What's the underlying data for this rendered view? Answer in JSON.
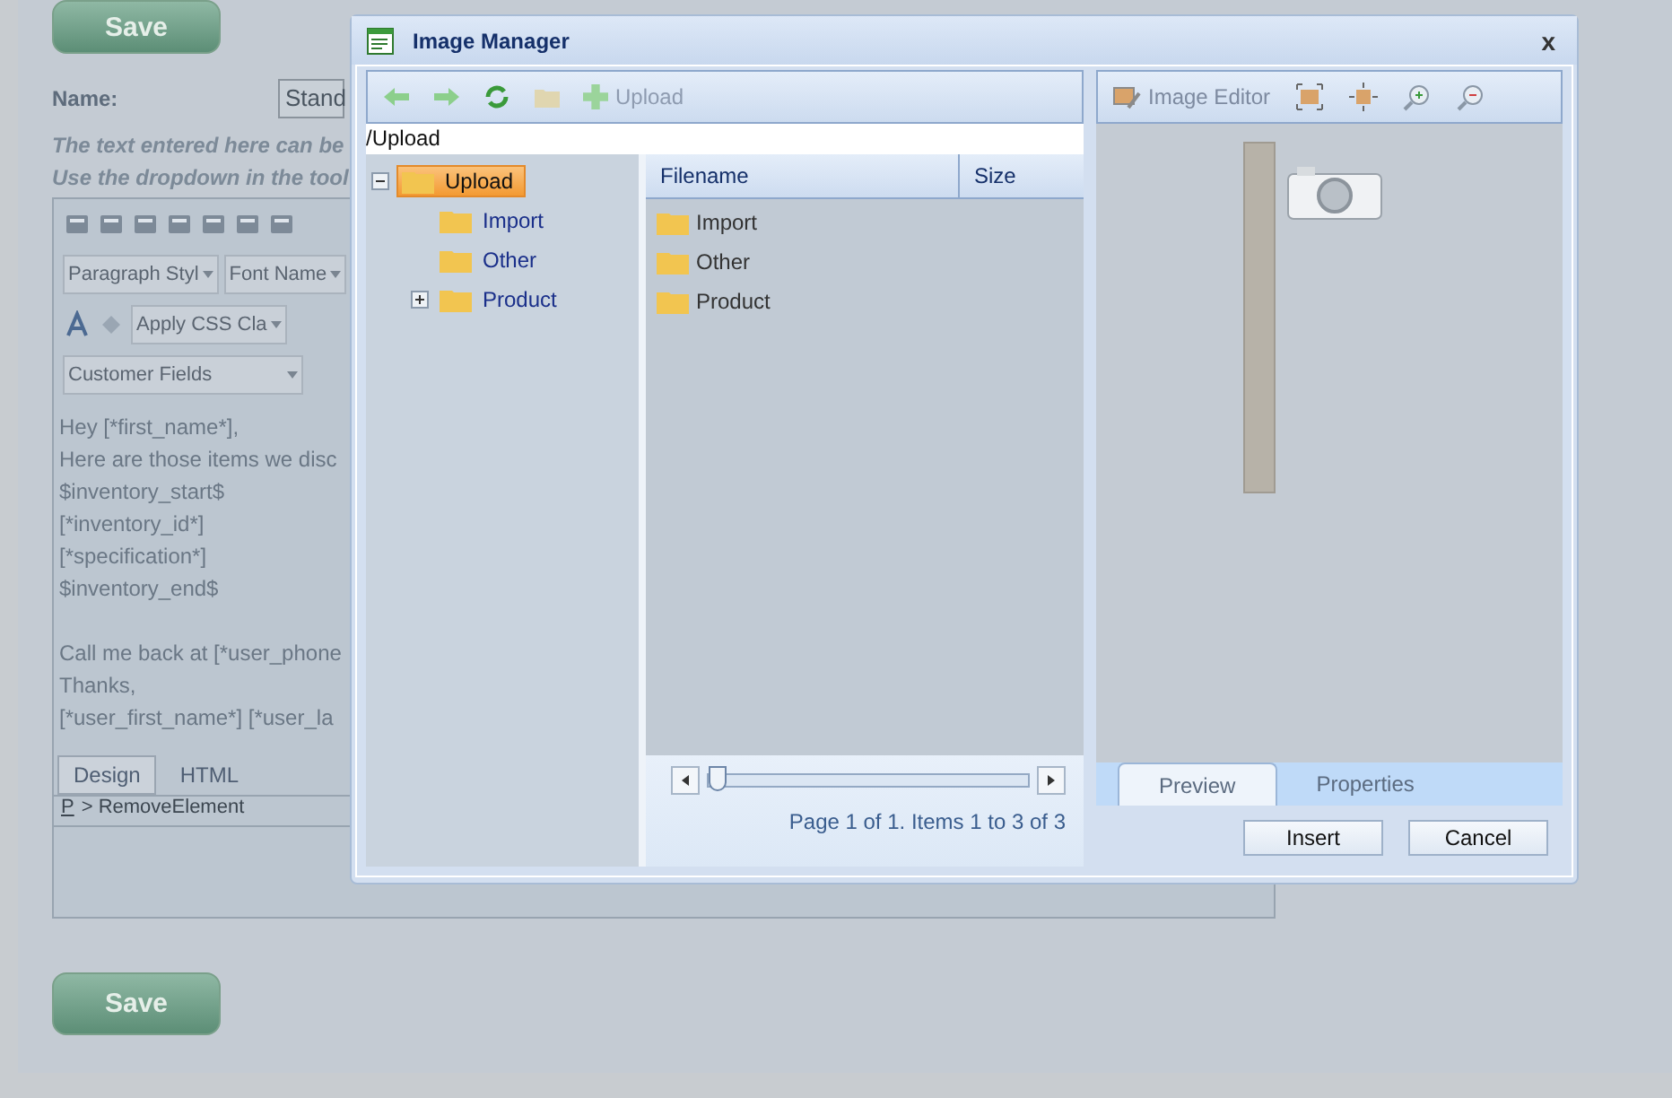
{
  "page": {
    "save_top": "Save",
    "name_label": "Name:",
    "name_value": "Stand",
    "help_lines": [
      "The text entered here can be",
      "Use the dropdown in the tool"
    ],
    "editor": {
      "dropdowns": [
        {
          "kind": "toolbar",
          "label": "Paragraph Styl"
        },
        {
          "kind": "toolbar",
          "label": "Font Name"
        },
        {
          "kind": "css",
          "label": "Apply CSS Cla"
        },
        {
          "kind": "fields",
          "label": "Customer Fields"
        }
      ],
      "paragraphs": [
        [
          "Hey [*first_name*],",
          "Here are those items we disc",
          "$inventory_start$",
          "[*inventory_id*]",
          "[*specification*]",
          "$inventory_end$"
        ],
        [
          "Call me back at [*user_phone",
          "Thanks,",
          "[*user_first_name*] [*user_la"
        ]
      ],
      "mode_tabs": [
        {
          "label": "Design",
          "selected": true
        },
        {
          "label": "HTML",
          "selected": false
        }
      ],
      "breadcrumb": {
        "tag": "P",
        "path": "> RemoveElement"
      }
    },
    "save_bottom": "Save"
  },
  "dialog": {
    "title": "Image Manager",
    "close": "x",
    "upload": "Upload",
    "path": "/Upload",
    "tree": [
      {
        "label": "Upload",
        "selected": true,
        "expanded": true,
        "children": [
          {
            "label": "Import",
            "selected": false,
            "has_children": false
          },
          {
            "label": "Other",
            "selected": false,
            "has_children": false
          },
          {
            "label": "Product",
            "selected": false,
            "has_children": true
          }
        ]
      }
    ],
    "files": {
      "columns": [
        "Filename",
        "Size"
      ],
      "rows": [
        {
          "name": "Import"
        },
        {
          "name": "Other"
        },
        {
          "name": "Product"
        }
      ]
    },
    "pager": {
      "level": 0.0,
      "text": "Page 1 of 1. Items 1 to 3 of 3"
    },
    "image_editor": "Image Editor",
    "tabs": [
      {
        "label": "Preview",
        "selected": true
      },
      {
        "label": "Properties",
        "selected": false
      }
    ],
    "buttons": [
      "Insert",
      "Cancel"
    ]
  }
}
